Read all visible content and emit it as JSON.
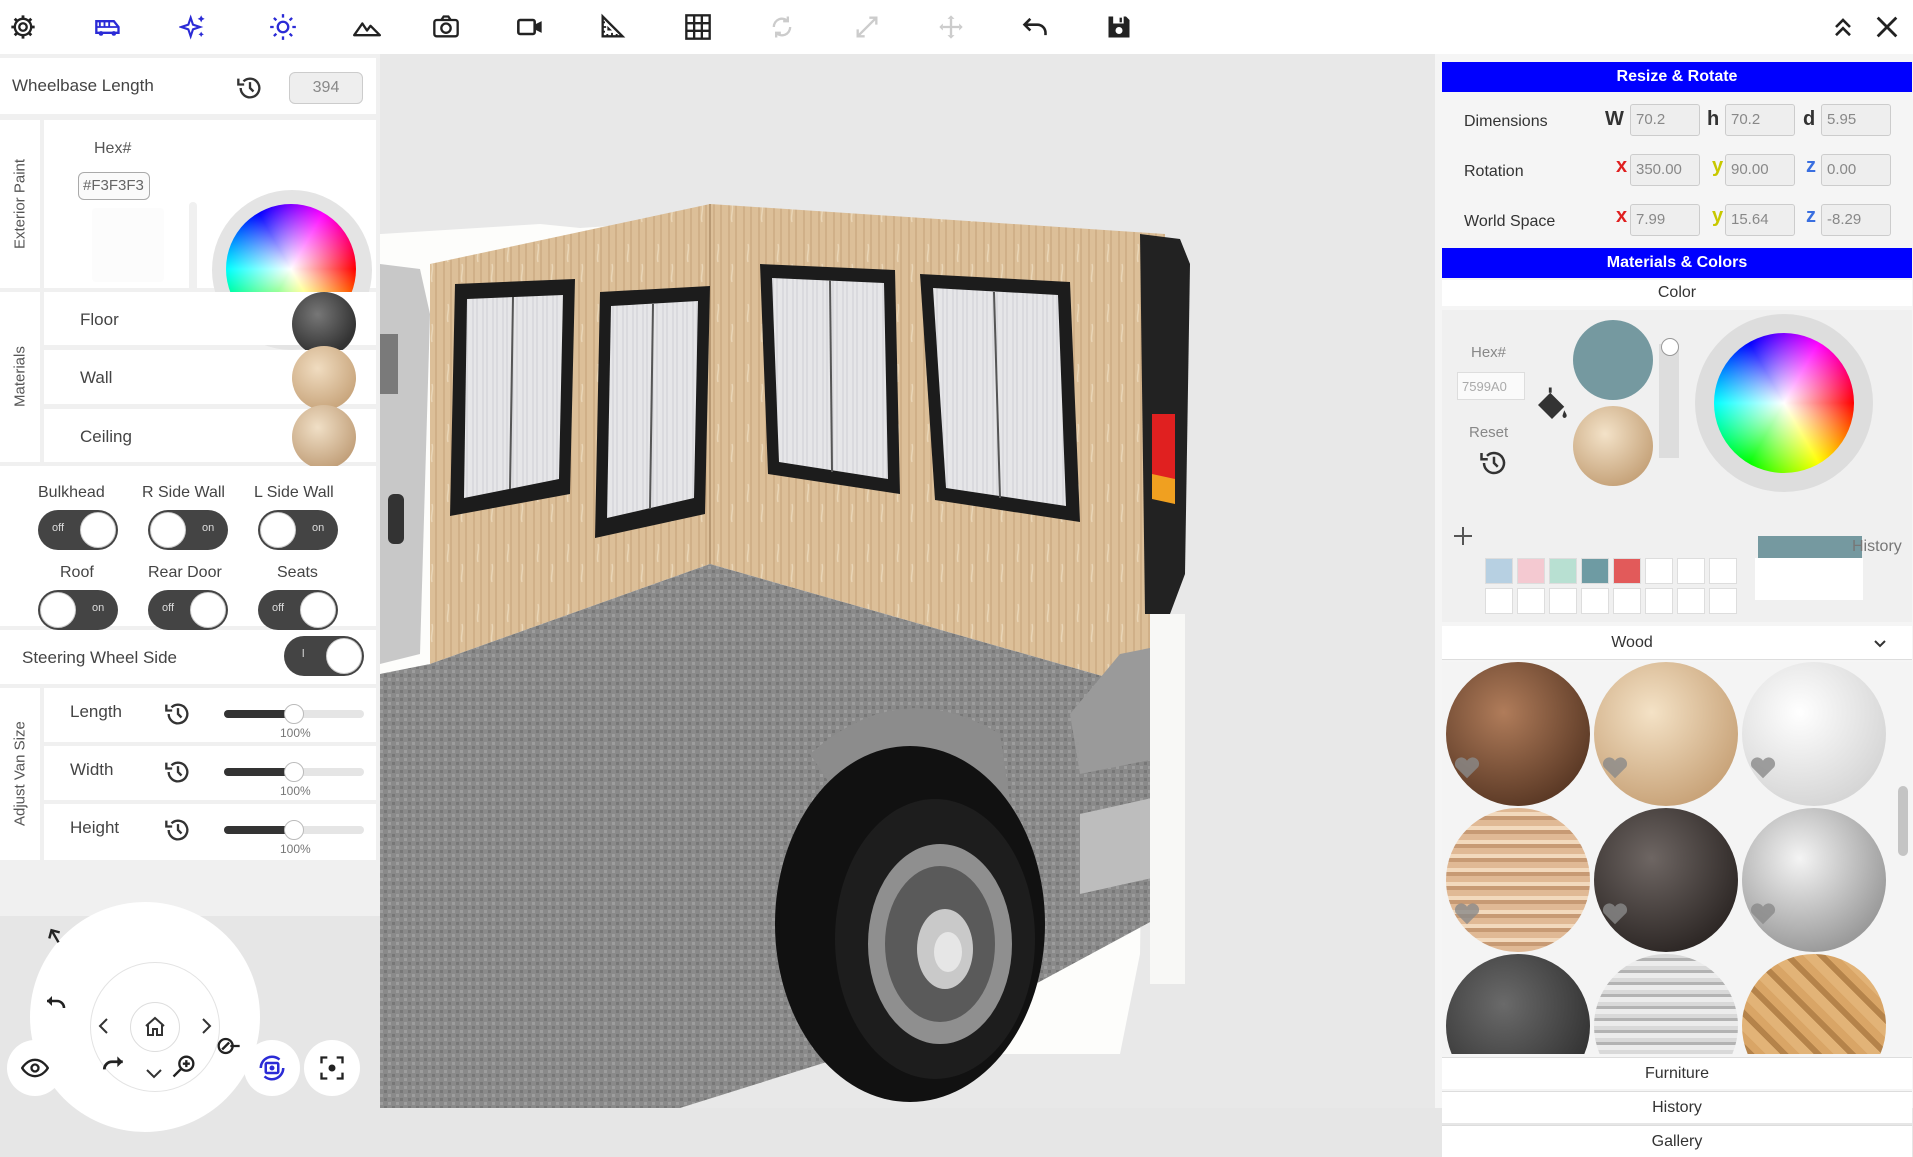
{
  "toolbar": {
    "icons": [
      "settings-icon",
      "van-icon",
      "sparkle-icon",
      "sun-icon",
      "terrain-icon",
      "camera-icon",
      "video-icon",
      "ruler-icon",
      "grid-icon",
      "rotate-icon",
      "resize-icon",
      "move-icon",
      "undo-icon",
      "save-icon",
      "collapse-icon",
      "close-icon"
    ],
    "active_color": "#2b2bd6"
  },
  "left": {
    "wheelbase_label": "Wheelbase Length",
    "wheelbase_value": "394",
    "exterior_paint_label": "Exterior Paint",
    "hex_label": "Hex#",
    "hex_value": "#F3F3F3",
    "materials_label": "Materials",
    "materials": [
      {
        "label": "Floor"
      },
      {
        "label": "Wall"
      },
      {
        "label": "Ceiling"
      }
    ],
    "toggles": [
      {
        "label": "Bulkhead",
        "state": "off"
      },
      {
        "label": "R Side Wall",
        "state": "on"
      },
      {
        "label": "L Side Wall",
        "state": "on"
      },
      {
        "label": "Roof",
        "state": "on"
      },
      {
        "label": "Rear Door",
        "state": "off"
      },
      {
        "label": "Seats",
        "state": "off"
      }
    ],
    "steering_label": "Steering Wheel Side",
    "steering_state": "l",
    "adjust_label": "Adjust Van Size",
    "size": [
      {
        "label": "Length",
        "percent": "100%",
        "fill": 0.5
      },
      {
        "label": "Width",
        "percent": "100%",
        "fill": 0.5
      },
      {
        "label": "Height",
        "percent": "100%",
        "fill": 0.5
      }
    ]
  },
  "right": {
    "resize_header": "Resize & Rotate",
    "dimensions_label": "Dimensions",
    "rotation_label": "Rotation",
    "world_label": "World Space",
    "dim_axes": [
      "W",
      "h",
      "d"
    ],
    "xyz_axes": [
      "x",
      "y",
      "z"
    ],
    "dimensions": [
      "70.2",
      "70.2",
      "5.95"
    ],
    "rotation": [
      "350.00",
      "90.00",
      "0.00"
    ],
    "world": [
      "7.99",
      "15.64",
      "-8.29"
    ],
    "materials_header": "Materials & Colors",
    "color_label": "Color",
    "hex_label": "Hex#",
    "hex_value": "7599A0",
    "reset_label": "Reset",
    "history_label": "History",
    "selected_color": "#7599A0",
    "swatches": [
      "#b7d0e2",
      "#f4c9d1",
      "#b8e0d2",
      "#6e9ba3",
      "#e25a5a"
    ],
    "category": "Wood",
    "tabs": [
      "Furniture",
      "History",
      "Gallery"
    ]
  }
}
